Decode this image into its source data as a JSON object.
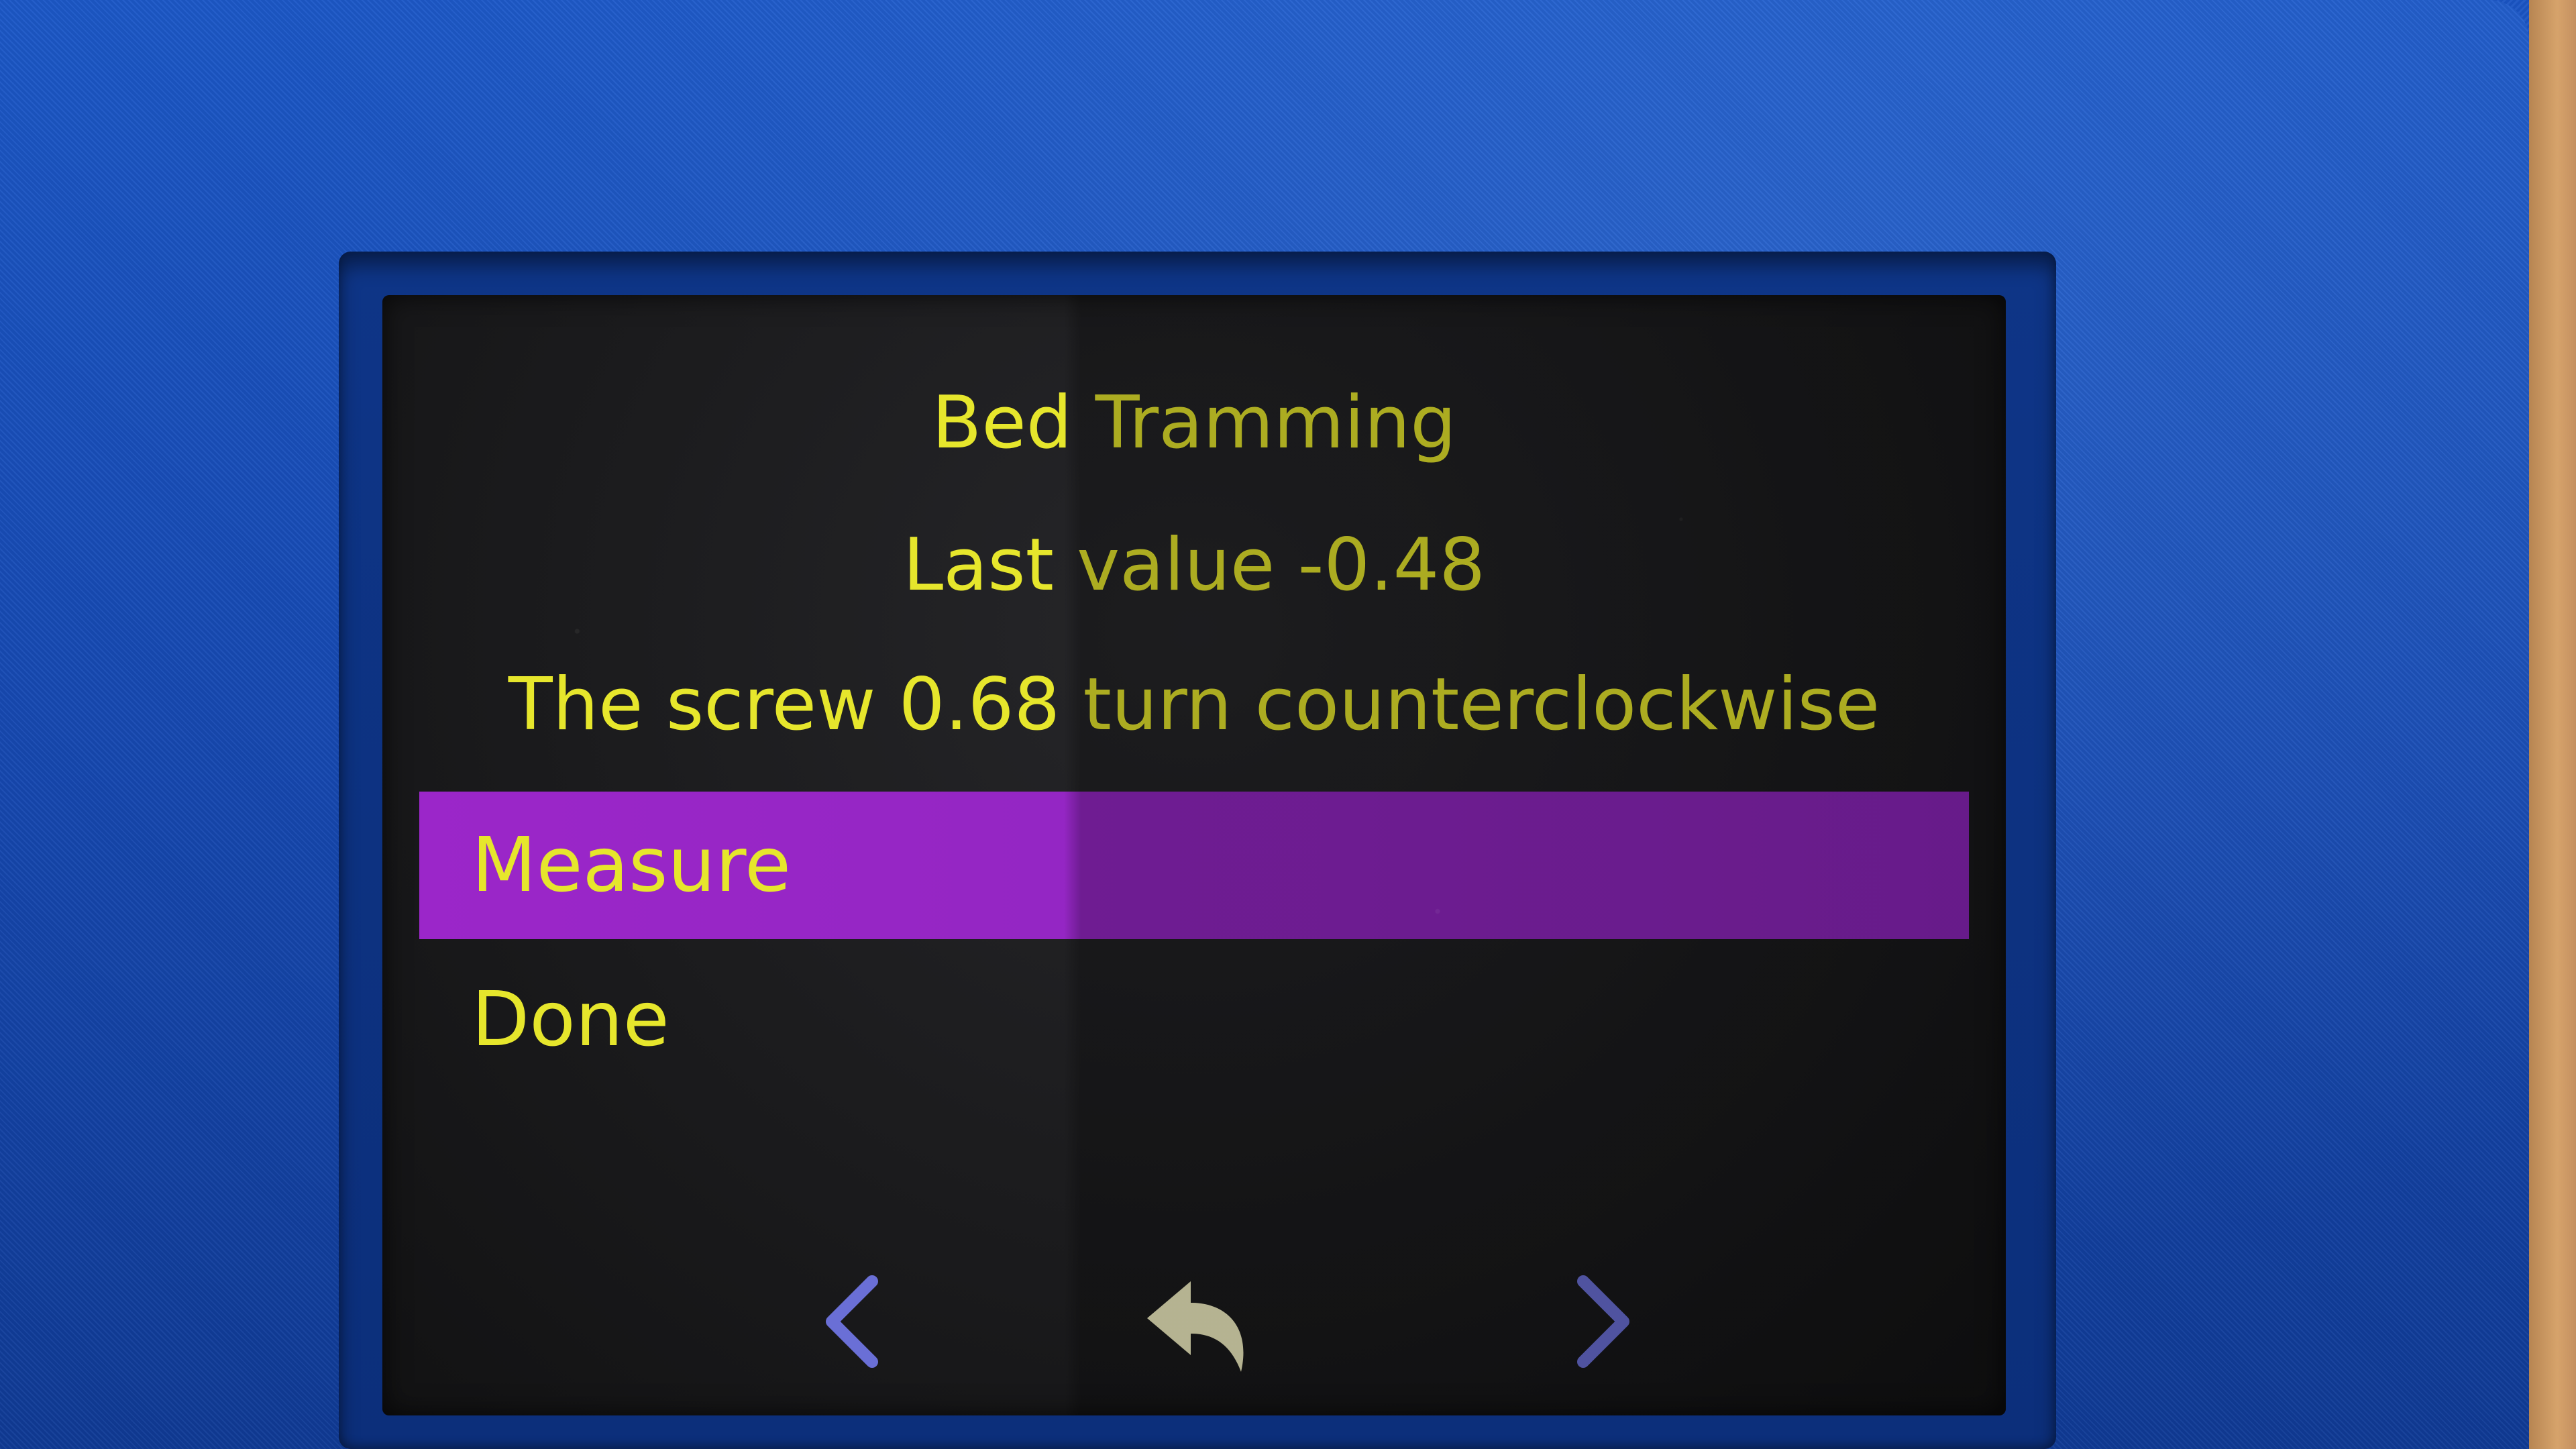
{
  "screen": {
    "title": "Bed Tramming",
    "last_value": "Last value -0.48",
    "instruction": "The screw 0.68 turn counterclockwise"
  },
  "menu": {
    "items": [
      {
        "label": "Measure",
        "selected": true
      },
      {
        "label": "Done",
        "selected": false
      }
    ]
  },
  "navigation": {
    "prev_icon": "chevron-left-icon",
    "back_icon": "return-arrow-icon",
    "next_icon": "chevron-right-icon"
  },
  "colors": {
    "text": "#e6e62c",
    "highlight": "#9b26c9",
    "screen_background": "#1e1e20",
    "nav_arrows": "#6a6fd6",
    "back_arrow": "#f2efc2",
    "enclosure": "#1a54c4"
  }
}
